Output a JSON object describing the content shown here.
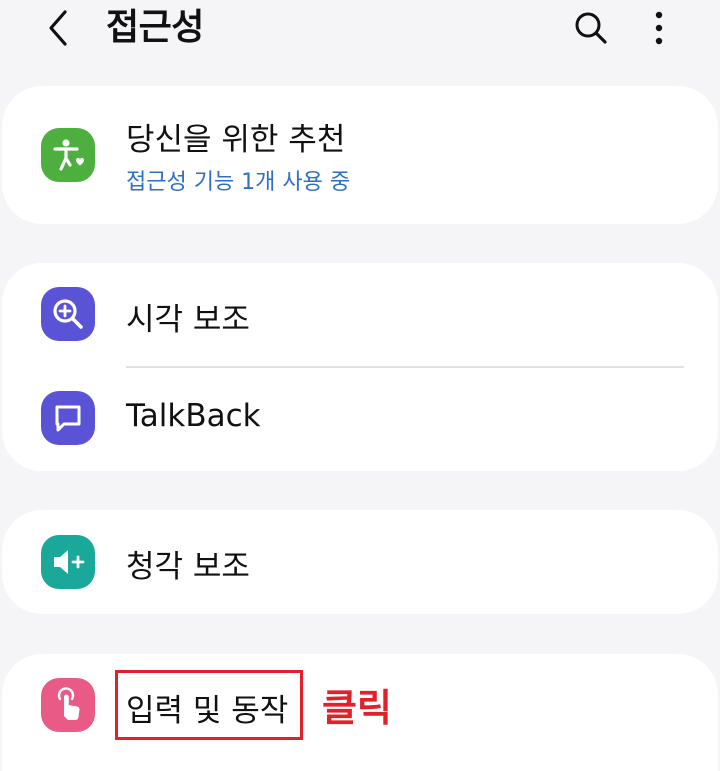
{
  "header": {
    "title": "접근성",
    "back_icon": "chevron-left-icon",
    "search_icon": "search-icon",
    "more_icon": "more-vertical-icon"
  },
  "recommended": {
    "label": "당신을 위한 추천",
    "subtitle": "접근성 기능 1개 사용 중",
    "icon": "accessibility-person-heart-icon",
    "icon_color": "#4caf3e",
    "subtitle_color": "#2e6fc7"
  },
  "items": [
    {
      "label": "시각 보조",
      "icon": "magnifier-plus-icon",
      "icon_color": "#5b53d6"
    },
    {
      "label": "TalkBack",
      "icon": "speech-bubble-icon",
      "icon_color": "#5b53d6"
    },
    {
      "label": "청각 보조",
      "icon": "speaker-plus-icon",
      "icon_color": "#1aa89a"
    },
    {
      "label": "입력 및 동작",
      "icon": "touch-hand-icon",
      "icon_color": "#ea5a86"
    }
  ],
  "annotation": {
    "text": "클릭",
    "color": "#e0202a"
  }
}
